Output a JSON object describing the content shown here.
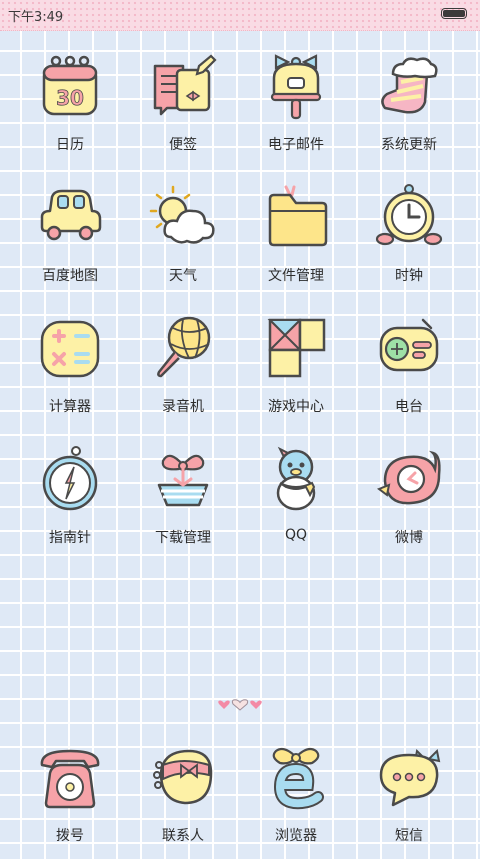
{
  "status_bar": {
    "time": "下午3:49",
    "battery_level": 1.0
  },
  "apps": {
    "calendar": {
      "label": "日历",
      "icon": "calendar-icon",
      "date_number": "30"
    },
    "notes": {
      "label": "便签",
      "icon": "notepad-icon"
    },
    "email": {
      "label": "电子邮件",
      "icon": "mailbox-icon"
    },
    "system_update": {
      "label": "系统更新",
      "icon": "stocking-icon"
    },
    "baidu_map": {
      "label": "百度地图",
      "icon": "car-icon"
    },
    "weather": {
      "label": "天气",
      "icon": "sun-cloud-icon"
    },
    "file_manager": {
      "label": "文件管理",
      "icon": "folder-icon"
    },
    "clock": {
      "label": "时钟",
      "icon": "alarm-clock-icon"
    },
    "calculator": {
      "label": "计算器",
      "icon": "calculator-icon"
    },
    "recorder": {
      "label": "录音机",
      "icon": "microphone-icon"
    },
    "game_center": {
      "label": "游戏中心",
      "icon": "puzzle-blocks-icon"
    },
    "radio": {
      "label": "电台",
      "icon": "radio-icon"
    },
    "compass": {
      "label": "指南针",
      "icon": "compass-icon"
    },
    "download_manager": {
      "label": "下载管理",
      "icon": "gift-box-icon"
    },
    "qq": {
      "label": "QQ",
      "icon": "penguin-icon"
    },
    "weibo": {
      "label": "微博",
      "icon": "weibo-bird-icon"
    }
  },
  "dock": {
    "dialer": {
      "label": "拨号",
      "icon": "telephone-icon"
    },
    "contacts": {
      "label": "联系人",
      "icon": "address-book-icon"
    },
    "browser": {
      "label": "浏览器",
      "icon": "browser-e-icon"
    },
    "messages": {
      "label": "短信",
      "icon": "speech-bubble-icon"
    }
  },
  "page_indicator": {
    "pages": 3,
    "current": 2
  },
  "colors": {
    "status_bar_bg": "#f9dbe4",
    "grid_bg": "#dfe9f6",
    "outline": "#4a4a4a",
    "pastel_yellow": "#fdf1a6",
    "pastel_pink": "#f6a3a8",
    "pastel_blue": "#a9dcf0"
  }
}
